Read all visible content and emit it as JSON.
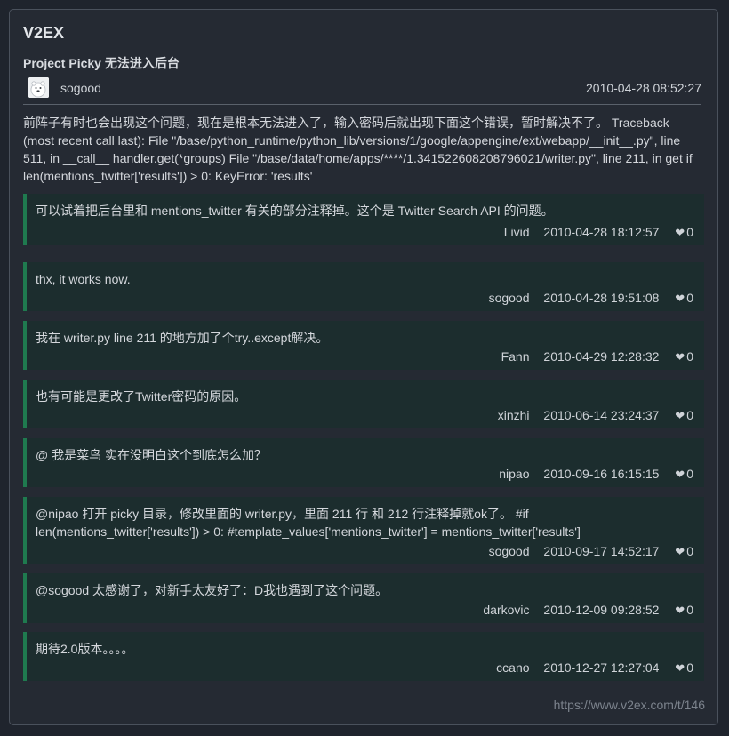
{
  "site": {
    "name": "V2EX"
  },
  "topic": {
    "title": "Project Picky 无法进入后台",
    "author": "sogood",
    "time": "2010-04-28 08:52:27",
    "body": "前阵子有时也会出现这个问题，现在是根本无法进入了，输入密码后就出现下面这个错误，暂时解决不了。 Traceback (most recent call last): File \"/base/python_runtime/python_lib/versions/1/google/appengine/ext/webapp/__init__.py\", line 511, in __call__ handler.get(*groups) File \"/base/data/home/apps/****/1.341522608208796021/writer.py\", line 211, in get if len(mentions_twitter['results']) > 0: KeyError: 'results'"
  },
  "replies": [
    {
      "text": "可以试着把后台里和 mentions_twitter 有关的部分注释掉。这个是 Twitter Search API 的问题。",
      "user": "Livid",
      "time": "2010-04-28 18:12:57",
      "likes": "0"
    },
    {
      "text": "thx, it works now.",
      "user": "sogood",
      "time": "2010-04-28 19:51:08",
      "likes": "0"
    },
    {
      "text": "我在 writer.py line 211 的地方加了个try..except解决。",
      "user": "Fann",
      "time": "2010-04-29 12:28:32",
      "likes": "0"
    },
    {
      "text": "也有可能是更改了Twitter密码的原因。",
      "user": "xinzhi",
      "time": "2010-06-14 23:24:37",
      "likes": "0"
    },
    {
      "text": "@ 我是菜鸟 实在没明白这个到底怎么加？",
      "user": "nipao",
      "time": "2010-09-16 16:15:15",
      "likes": "0"
    },
    {
      "text": "@nipao 打开 picky 目录，修改里面的 writer.py，里面 211 行 和 212 行注释掉就ok了。 #if len(mentions_twitter['results']) > 0: #template_values['mentions_twitter'] = mentions_twitter['results']",
      "user": "sogood",
      "time": "2010-09-17 14:52:17",
      "likes": "0"
    },
    {
      "text": "@sogood 太感谢了，对新手太友好了：D我也遇到了这个问题。",
      "user": "darkovic",
      "time": "2010-12-09 09:28:52",
      "likes": "0"
    },
    {
      "text": "期待2.0版本。。。。",
      "user": "ccano",
      "time": "2010-12-27 12:27:04",
      "likes": "0"
    }
  ],
  "footer": {
    "url": "https://www.v2ex.com/t/146"
  },
  "icons": {
    "like": "heart-icon",
    "avatar": "polar-bear-avatar"
  },
  "colors": {
    "accent": "#1f7a4f",
    "reply_bg": "#1c2d2e",
    "card_bg": "#252a33"
  }
}
